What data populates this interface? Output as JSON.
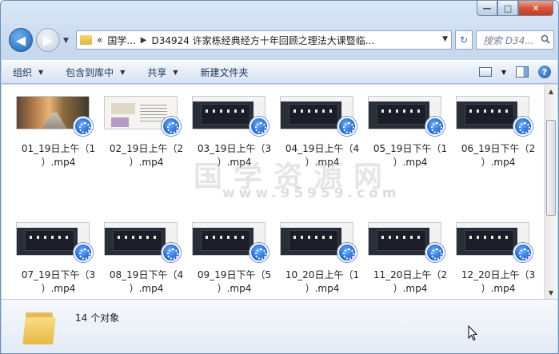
{
  "window": {
    "buttons": {
      "minimize": "—",
      "maximize": "□",
      "close": "✕"
    }
  },
  "nav": {
    "back_icon": "◀",
    "forward_icon": "▶",
    "recent_icon": "▼"
  },
  "address": {
    "chevrons": "«",
    "segments": [
      "国学...",
      "D34924 许家栋经典经方十年回顾之理法大课暨临..."
    ],
    "separator": "▶",
    "dropdown": "▼",
    "refresh_icon": "↻"
  },
  "search": {
    "placeholder": "搜索 D34..."
  },
  "toolbar": {
    "organize": "组织",
    "include_library": "包含到库中",
    "share": "共享",
    "new_folder": "新建文件夹",
    "dropdown_arrow": "▼",
    "help": "?"
  },
  "files": [
    {
      "line1": "01_19日上午（1",
      "line2": "）.mp4",
      "thumb": "photo"
    },
    {
      "line1": "02_19日上午（2",
      "line2": "）.mp4",
      "thumb": "doc"
    },
    {
      "line1": "03_19日上午（3",
      "line2": "）.mp4",
      "thumb": "screen"
    },
    {
      "line1": "04_19日上午（4",
      "line2": "）.mp4",
      "thumb": "screen"
    },
    {
      "line1": "05_19日下午（1",
      "line2": "）.mp4",
      "thumb": "screen"
    },
    {
      "line1": "06_19日下午（2",
      "line2": "）.mp4",
      "thumb": "screen"
    },
    {
      "line1": "07_19日下午（3",
      "line2": "）.mp4",
      "thumb": "screen"
    },
    {
      "line1": "08_19日下午（4",
      "line2": "）.mp4",
      "thumb": "screen"
    },
    {
      "line1": "09_19日下午（5",
      "line2": "）.mp4",
      "thumb": "screen"
    },
    {
      "line1": "10_20日上午（1",
      "line2": "）.mp4",
      "thumb": "screen"
    },
    {
      "line1": "11_20日上午（2",
      "line2": "）.mp4",
      "thumb": "screen"
    },
    {
      "line1": "12_20日上午（3",
      "line2": "）.mp4",
      "thumb": "screen"
    }
  ],
  "watermark": {
    "text": "国学资源网",
    "url": "www.95959.com"
  },
  "scrollbar": {
    "up": "▲",
    "down": "▼"
  },
  "status": {
    "count": "14 个对象"
  },
  "colors": {
    "toolbar_text": "#1e395b",
    "window_frame": "#c6d9ef",
    "close_button": "#c73a1f"
  }
}
